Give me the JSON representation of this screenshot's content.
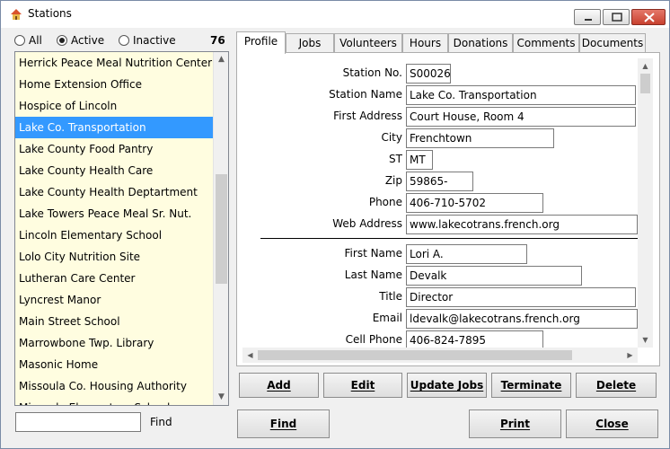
{
  "window": {
    "title": "Stations"
  },
  "filter": {
    "options": [
      {
        "label": "All",
        "selected": false
      },
      {
        "label": "Active",
        "selected": true
      },
      {
        "label": "Inactive",
        "selected": false
      }
    ],
    "count": "76"
  },
  "stations": [
    "Herrick Peace Meal Nutrition Center",
    "Home Extension Office",
    "Hospice of Lincoln",
    "Lake Co. Transportation",
    "Lake County Food Pantry",
    "Lake County Health Care",
    "Lake County Health Deptartment",
    "Lake Towers Peace Meal Sr. Nut.",
    "Lincoln Elementary School",
    "Lolo City Nutrition Site",
    "Lutheran Care Center",
    "Lyncrest Manor",
    "Main Street School",
    "Marrowbone Twp. Library",
    "Masonic Home",
    "Missoula Co. Housing Authority",
    "Missoula Elementary Schools"
  ],
  "selected_station": "Lake Co. Transportation",
  "find": {
    "value": "",
    "label": "Find"
  },
  "tabs": [
    "Profile",
    "Jobs",
    "Volunteers",
    "Hours",
    "Donations",
    "Comments",
    "Documents"
  ],
  "active_tab": "Profile",
  "profile": {
    "station_no_label": "Station No.",
    "station_no": "S00026",
    "station_name_label": "Station Name",
    "station_name": "Lake Co. Transportation",
    "first_address_label": "First Address",
    "first_address": "Court House, Room 4",
    "city_label": "City",
    "city": "Frenchtown",
    "st_label": "ST",
    "st": "MT",
    "zip_label": "Zip",
    "zip": "59865-",
    "phone_label": "Phone",
    "phone": "406-710-5702",
    "web_label": "Web Address",
    "web": "www.lakecotrans.french.org",
    "first_name_label": "First Name",
    "first_name": "Lori A.",
    "last_name_label": "Last Name",
    "last_name": "Devalk",
    "title_label": "Title",
    "title": "Director",
    "email_label": "Email",
    "email": "ldevalk@lakecotrans.french.org",
    "cell_label": "Cell Phone",
    "cell": "406-824-7895"
  },
  "actions": {
    "add": "Add",
    "edit": "Edit",
    "update_jobs": "Update Jobs",
    "terminate": "Terminate",
    "delete": "Delete",
    "find": "Find",
    "print": "Print",
    "close": "Close"
  }
}
